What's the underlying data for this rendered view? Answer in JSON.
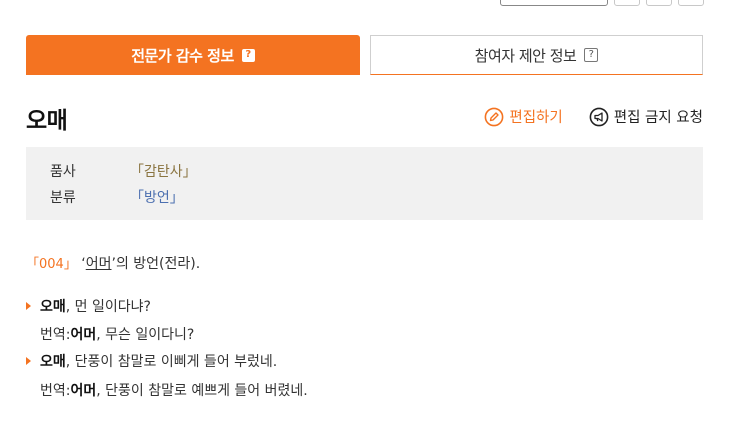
{
  "tabs": {
    "expert_label": "전문가 감수 정보",
    "participant_label": "참여자 제안 정보",
    "help_glyph": "?"
  },
  "entry": {
    "word": "오매",
    "edit_label": "편집하기",
    "block_label": "편집 금지 요청"
  },
  "info": {
    "pos_key": "품사",
    "pos_value": "「감탄사」",
    "cat_key": "분류",
    "cat_value": "「방언」"
  },
  "definition": {
    "number": "「004」",
    "quote_open": "‘",
    "ref_word": "어머",
    "rest": "’의 방언(전라)."
  },
  "examples": [
    {
      "head": "오매",
      "text": ", 먼 일이다냐?"
    },
    {
      "prefix": "번역: ",
      "head": "어머",
      "text": ", 무슨 일이다니?"
    },
    {
      "head": "오매",
      "text": ", 단풍이 참말로 이삐게 들어 부렀네."
    },
    {
      "prefix": "번역: ",
      "head": "어머",
      "text": ", 단풍이 참말로 예쁘게 들어 버렸네."
    }
  ],
  "colors": {
    "accent": "#f47321",
    "pos": "#8a7440",
    "category": "#4b6fb0"
  },
  "icons": {
    "edit": "pencil-circle-icon",
    "block": "megaphone-circle-icon"
  }
}
